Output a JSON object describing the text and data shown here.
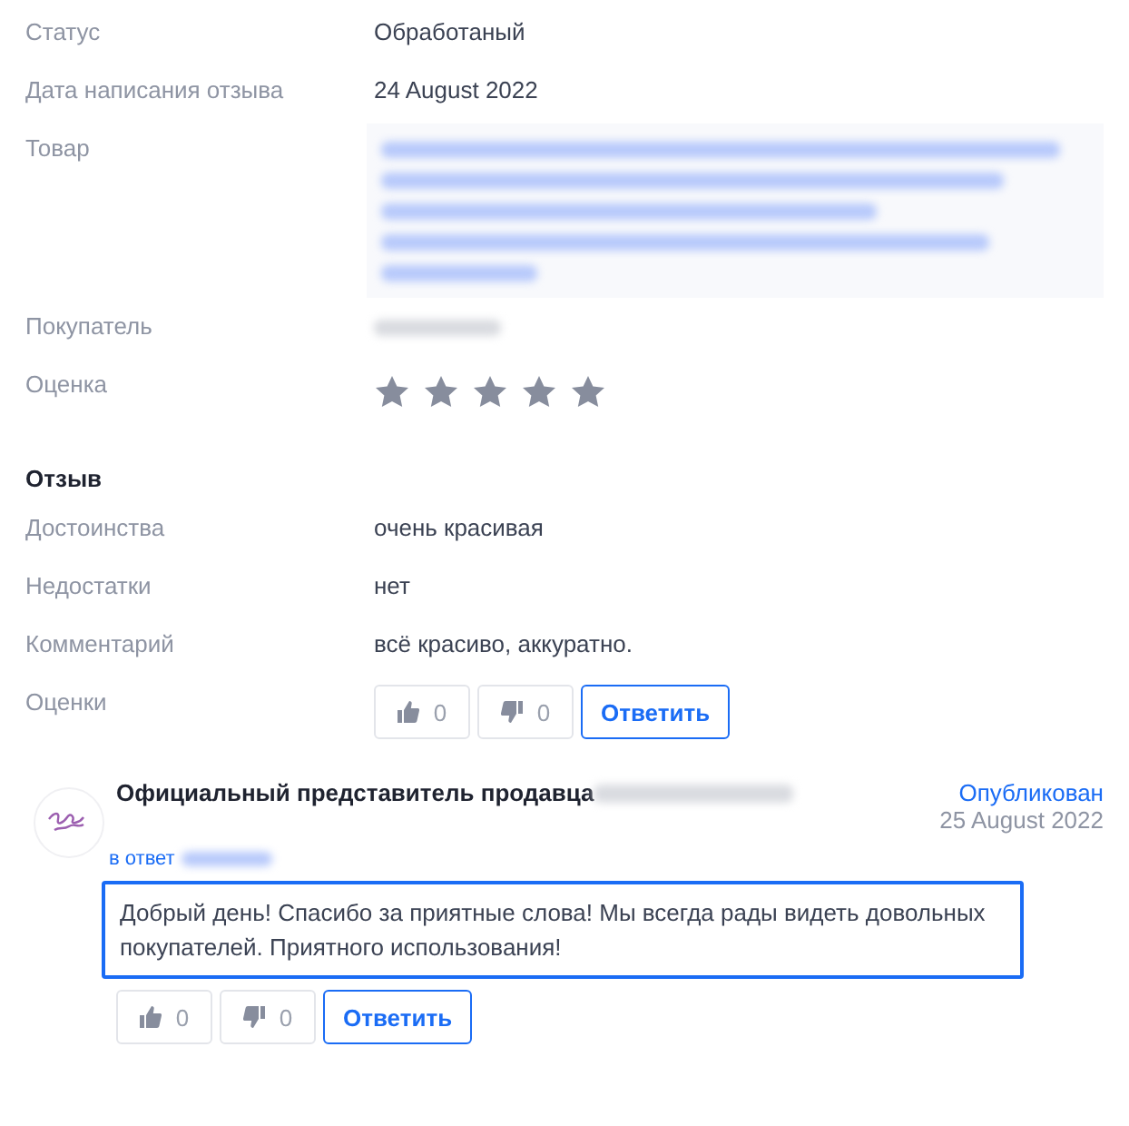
{
  "details": [
    {
      "label": "Статус",
      "value": "Обработаный",
      "kind": "text"
    },
    {
      "label": "Дата написания отзыва",
      "value": "24 August 2022",
      "kind": "text"
    },
    {
      "label": "Товар",
      "kind": "blurred-block"
    },
    {
      "label": "Покупатель",
      "kind": "blurred-line"
    },
    {
      "label": "Оценка",
      "kind": "stars",
      "stars": 5
    }
  ],
  "review": {
    "title": "Отзыв",
    "rows": [
      {
        "label": "Достоинства",
        "value": "очень красивая"
      },
      {
        "label": "Недостатки",
        "value": "нет"
      },
      {
        "label": "Комментарий",
        "value": "всё красиво, аккуратно."
      }
    ],
    "votes_label": "Оценки",
    "likes": "0",
    "dislikes": "0",
    "reply_button": "Ответить"
  },
  "answer": {
    "author": "Официальный представитель продавца",
    "status": "Опубликован",
    "date": "25 August 2022",
    "in_reply_to": "в ответ",
    "text": "Добрый день! Спасибо за приятные слова! Мы всегда рады видеть довольных покупателей. Приятного использования!",
    "highlighted": true,
    "likes": "0",
    "dislikes": "0",
    "reply_button": "Ответить"
  }
}
